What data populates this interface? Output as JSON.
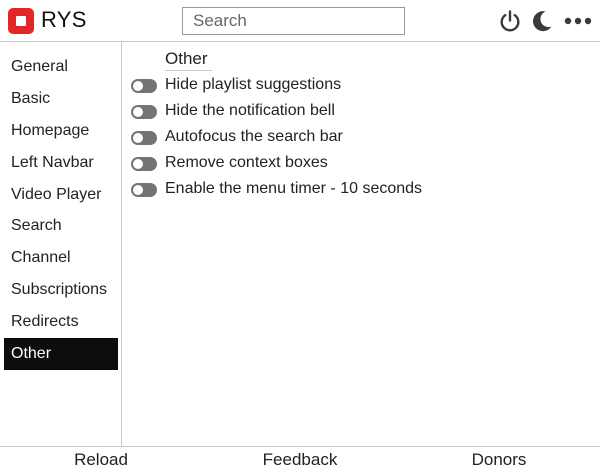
{
  "header": {
    "app_title": "RYS",
    "search_placeholder": "Search",
    "search_value": "",
    "icons": [
      "power-icon",
      "moon-icon",
      "more-dots-icon"
    ],
    "logo_color": "#e2272b"
  },
  "sidebar": {
    "items": [
      {
        "label": "General"
      },
      {
        "label": "Basic"
      },
      {
        "label": "Homepage"
      },
      {
        "label": "Left Navbar"
      },
      {
        "label": "Video Player"
      },
      {
        "label": "Search"
      },
      {
        "label": "Channel"
      },
      {
        "label": "Subscriptions"
      },
      {
        "label": "Redirects"
      },
      {
        "label": "Other"
      }
    ],
    "active_label": "Other"
  },
  "main": {
    "section_title": "Other",
    "options": [
      {
        "label": "Hide playlist suggestions",
        "enabled": false
      },
      {
        "label": "Hide the notification bell",
        "enabled": false
      },
      {
        "label": "Autofocus the search bar",
        "enabled": false
      },
      {
        "label": "Remove context boxes",
        "enabled": false
      },
      {
        "label": "Enable the menu timer - 10 seconds",
        "enabled": false
      }
    ]
  },
  "footer": {
    "reload_label": "Reload",
    "feedback_label": "Feedback",
    "donors_label": "Donors"
  },
  "colors": {
    "accent": "#e2272b",
    "active_nav_bg": "#0d0d0d",
    "toggle_off": "#747474"
  }
}
